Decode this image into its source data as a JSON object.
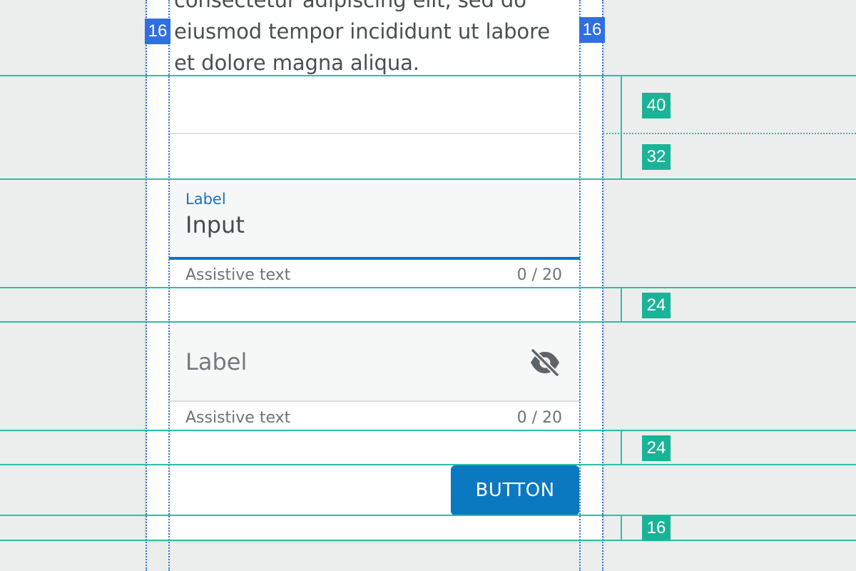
{
  "content": {
    "paragraph": "consectetur adipiscing elit, sed do eiusmod tempor incididunt ut labore et dolore magna aliqua."
  },
  "field1": {
    "label": "Label",
    "value": "Input",
    "assistive": "Assistive text",
    "counter": "0 / 20"
  },
  "field2": {
    "label": "Label",
    "icon": "eye-off-icon",
    "assistive": "Assistive text",
    "counter": "0 / 20"
  },
  "button": {
    "label": "BUTTON"
  },
  "annotations": {
    "padding_left": "16",
    "padding_right": "16",
    "spacing_1": "40",
    "spacing_2": "32",
    "spacing_3": "24",
    "spacing_4": "24",
    "spacing_5": "16"
  },
  "colors": {
    "accent": "#0a79c0",
    "guide_blue": "#2f6fe0",
    "guide_teal": "#19b497",
    "background": "#eceeed"
  }
}
